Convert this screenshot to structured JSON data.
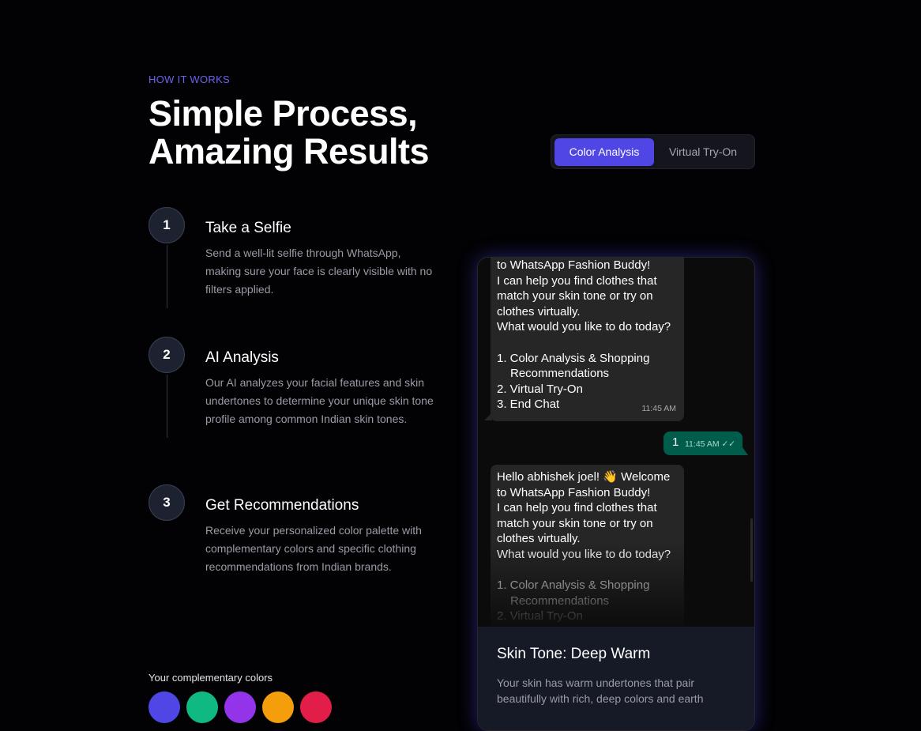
{
  "section": {
    "eyebrow": "HOW IT WORKS",
    "title_line1": "Simple Process,",
    "title_line2": "Amazing Results"
  },
  "tabs": [
    {
      "label": "Color Analysis",
      "active": true
    },
    {
      "label": "Virtual Try-On",
      "active": false
    }
  ],
  "steps": [
    {
      "number": "1",
      "title": "Take a Selfie",
      "description": "Send a well-lit selfie through WhatsApp, making sure your face is clearly visible with no filters applied."
    },
    {
      "number": "2",
      "title": "AI Analysis",
      "description": "Our AI analyzes your facial features and skin undertones to determine your unique skin tone profile among common Indian skin tones."
    },
    {
      "number": "3",
      "title": "Get Recommendations",
      "description": "Receive your personalized color palette with complementary colors and specific clothing recommendations from Indian brands."
    }
  ],
  "complementary": {
    "label": "Your complementary colors",
    "swatches": [
      "#4f46e5",
      "#10b981",
      "#9333ea",
      "#f59e0b",
      "#e11d48"
    ]
  },
  "chat": {
    "incoming_1": {
      "lines": [
        "to WhatsApp Fashion Buddy!",
        "I can help you find clothes that",
        "match your skin tone or try on",
        "clothes virtually.",
        "What would you like to do today?"
      ],
      "options": [
        "1. Color Analysis & Shopping",
        "Recommendations",
        "2. Virtual Try-On",
        "3. End Chat"
      ],
      "time": "11:45 AM"
    },
    "outgoing": {
      "text": "1",
      "time": "11:45 AM ✓✓"
    },
    "incoming_2": {
      "lines": [
        "Hello abhishek joel! 👋 Welcome",
        "to WhatsApp Fashion Buddy!",
        "I can help you find clothes that",
        "match your skin tone or try on",
        "clothes virtually.",
        "What would you like to do today?"
      ],
      "options": [
        "1. Color Analysis & Shopping",
        "Recommendations",
        "2. Virtual Try-On"
      ]
    }
  },
  "result_card": {
    "title": "Skin Tone: Deep Warm",
    "description": "Your skin has warm undertones that pair beautifully with rich, deep colors and earth"
  },
  "colors": {
    "accent": "#4f46e5",
    "eyebrow": "#6c63f0",
    "whatsapp_outgoing": "#005c4b",
    "whatsapp_incoming": "#262626"
  }
}
